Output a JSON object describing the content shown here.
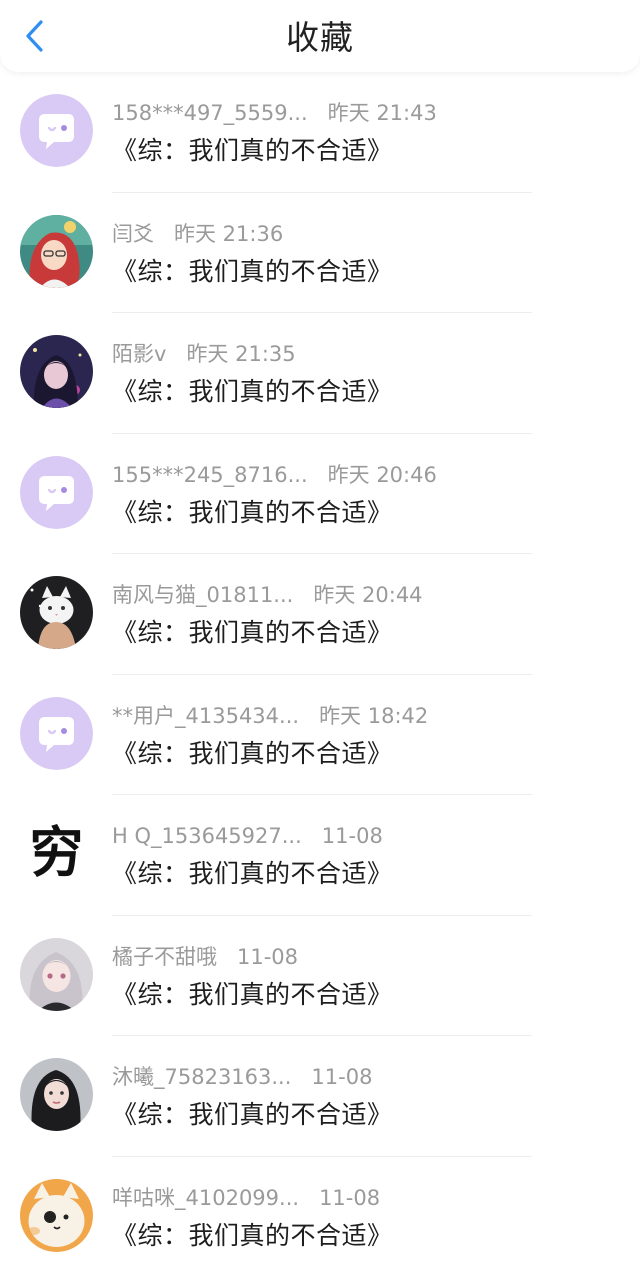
{
  "header": {
    "title": "收藏",
    "back_icon": "chevron-left-icon",
    "accent_color": "#2f8ef5"
  },
  "items": [
    {
      "name": "158***497_5559...",
      "time": "昨天 21:43",
      "message": "《综：我们真的不合适》",
      "avatar": "default-chat-bubble"
    },
    {
      "name": "闫爻",
      "time": "昨天 21:36",
      "message": "《综：我们真的不合适》",
      "avatar": "anime-girl-red-hair"
    },
    {
      "name": "陌影v",
      "time": "昨天 21:35",
      "message": "《综：我们真的不合适》",
      "avatar": "anime-girl-night"
    },
    {
      "name": "155***245_8716...",
      "time": "昨天 20:46",
      "message": "《综：我们真的不合适》",
      "avatar": "default-chat-bubble"
    },
    {
      "name": "南风与猫_01811...",
      "time": "昨天 20:44",
      "message": "《综：我们真的不合适》",
      "avatar": "white-cat-photo"
    },
    {
      "name": "**用户_4135434...",
      "time": "昨天 18:42",
      "message": "《综：我们真的不合适》",
      "avatar": "default-chat-bubble"
    },
    {
      "name": "H Q_153645927...",
      "time": "11-08",
      "message": "《综：我们真的不合适》",
      "avatar": "text-avatar",
      "avatar_text": "穷"
    },
    {
      "name": "橘子不甜哦",
      "time": "11-08",
      "message": "《综：我们真的不合适》",
      "avatar": "anime-girl-silver-hair"
    },
    {
      "name": "沐曦_75823163...",
      "time": "11-08",
      "message": "《综：我们真的不合适》",
      "avatar": "girl-portrait-dark-hair"
    },
    {
      "name": "咩咕咪_4102099...",
      "time": "11-08",
      "message": "《综：我们真的不合适》",
      "avatar": "cartoon-cat"
    }
  ]
}
